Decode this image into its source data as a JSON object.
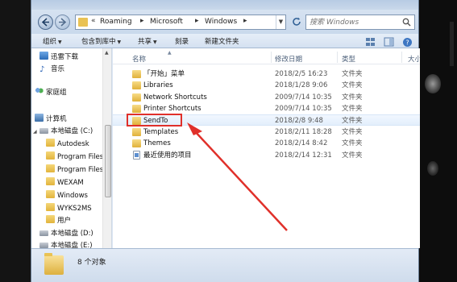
{
  "address": {
    "crumbs": [
      "Roaming",
      "Microsoft",
      "Windows"
    ],
    "search_placeholder": "搜索 Windows"
  },
  "toolbar": {
    "organize": "组织",
    "include_in_library": "包含到库中",
    "share": "共享",
    "burn": "刻录",
    "new_folder": "新建文件夹"
  },
  "nav": {
    "items": [
      {
        "label": "迅雷下载",
        "icon": "download-icon"
      },
      {
        "label": "音乐",
        "icon": "music-icon"
      },
      {
        "label": "家庭组",
        "icon": "homegroup-icon"
      },
      {
        "label": "计算机",
        "icon": "computer-icon"
      },
      {
        "label": "本地磁盘 (C:)",
        "icon": "drive-icon"
      },
      {
        "label": "Autodesk",
        "icon": "folder-icon"
      },
      {
        "label": "Program Files",
        "icon": "folder-icon"
      },
      {
        "label": "Program Files",
        "icon": "folder-icon"
      },
      {
        "label": "WEXAM",
        "icon": "folder-icon"
      },
      {
        "label": "Windows",
        "icon": "folder-icon"
      },
      {
        "label": "WYKS2MS",
        "icon": "folder-icon"
      },
      {
        "label": "用户",
        "icon": "folder-icon"
      },
      {
        "label": "本地磁盘 (D:)",
        "icon": "drive-icon"
      },
      {
        "label": "本地磁盘 (E:)",
        "icon": "drive-icon"
      }
    ]
  },
  "columns": {
    "name": "名称",
    "date": "修改日期",
    "type": "类型",
    "size": "大小"
  },
  "files": [
    {
      "name": "「开始」菜单",
      "date": "2018/2/5 16:23",
      "type": "文件夹",
      "icon": "folder-icon"
    },
    {
      "name": "Libraries",
      "date": "2018/1/28 9:06",
      "type": "文件夹",
      "icon": "folder-icon"
    },
    {
      "name": "Network Shortcuts",
      "date": "2009/7/14 10:35",
      "type": "文件夹",
      "icon": "folder-icon"
    },
    {
      "name": "Printer Shortcuts",
      "date": "2009/7/14 10:35",
      "type": "文件夹",
      "icon": "folder-icon"
    },
    {
      "name": "SendTo",
      "date": "2018/2/8 9:48",
      "type": "文件夹",
      "icon": "folder-icon"
    },
    {
      "name": "Templates",
      "date": "2018/2/11 18:28",
      "type": "文件夹",
      "icon": "folder-icon"
    },
    {
      "name": "Themes",
      "date": "2018/2/14 8:42",
      "type": "文件夹",
      "icon": "folder-icon"
    },
    {
      "name": "最近使用的项目",
      "date": "2018/2/14 12:31",
      "type": "文件夹",
      "icon": "file-icon"
    }
  ],
  "status": {
    "count_text": "8 个对象"
  },
  "annotation_color": "#e0302a"
}
